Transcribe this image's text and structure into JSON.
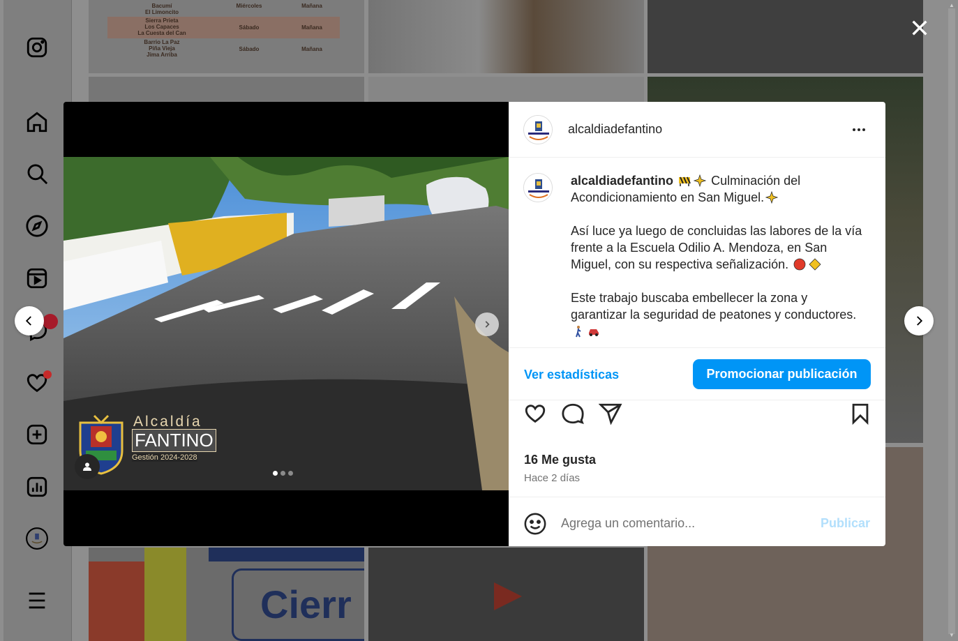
{
  "post": {
    "username": "alcaldiadefantino",
    "caption_line1": "Culminación del Acondicionamiento en San Miguel.",
    "caption_para2": "Así luce ya luego de concluidas las labores de la vía frente a la Escuela Odilio A. Mendoza, en San Miguel, con su respectiva señalización.",
    "caption_para3": "Este trabajo buscaba embellecer la zona y garantizar la seguridad de peatones y conductores.",
    "stats_label": "Ver estadísticas",
    "promote_label": "Promocionar publicación",
    "likes": "16 Me gusta",
    "time_ago": "Hace 2 días",
    "comment_placeholder": "Agrega un comentario...",
    "publish_label": "Publicar",
    "carousel_count": 3,
    "carousel_active": 1
  },
  "watermark": {
    "line1": "Alcaldía",
    "line2": "FANTINO",
    "line3": "Gestión 2024-2028"
  },
  "schedule_tile": {
    "rows": [
      {
        "places": "Bacumí\nEl Limoncito",
        "day": "Miércoles",
        "time": "Mañana"
      },
      {
        "places": "Sierra Prieta\nLos Capaces\nLa Cuesta del Can",
        "day": "Sábado",
        "time": "Mañana"
      },
      {
        "places": "Barrio La Paz\nPiña Vieja\nJima Arriba",
        "day": "Sábado",
        "time": "Mañana"
      }
    ]
  },
  "background_text": {
    "cierre_word": "Cierr"
  },
  "sidebar_icons": [
    "instagram-icon",
    "home-icon",
    "search-icon",
    "explore-icon",
    "reels-icon",
    "messages-icon",
    "notifications-icon",
    "create-icon",
    "dashboard-icon",
    "profile-icon",
    "menu-icon"
  ],
  "colors": {
    "accent": "#0095f6",
    "accent_disabled": "#b2dffc",
    "text": "#262626",
    "muted": "#737373"
  }
}
